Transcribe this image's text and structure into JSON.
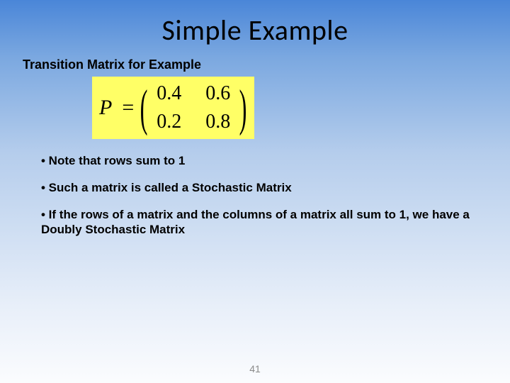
{
  "title": "Simple Example",
  "subtitle": "Transition Matrix for Example",
  "matrix": {
    "lhs": "P",
    "eq": "=",
    "r0c0": "0.4",
    "r0c1": "0.6",
    "r1c0": "0.2",
    "r1c1": "0.8"
  },
  "bullets": {
    "b1": "• Note that rows sum to 1",
    "b2": "• Such a matrix is called a Stochastic Matrix",
    "b3": "• If the rows of a matrix and the columns of a matrix all sum to 1, we have a Doubly Stochastic Matrix"
  },
  "page": "41"
}
